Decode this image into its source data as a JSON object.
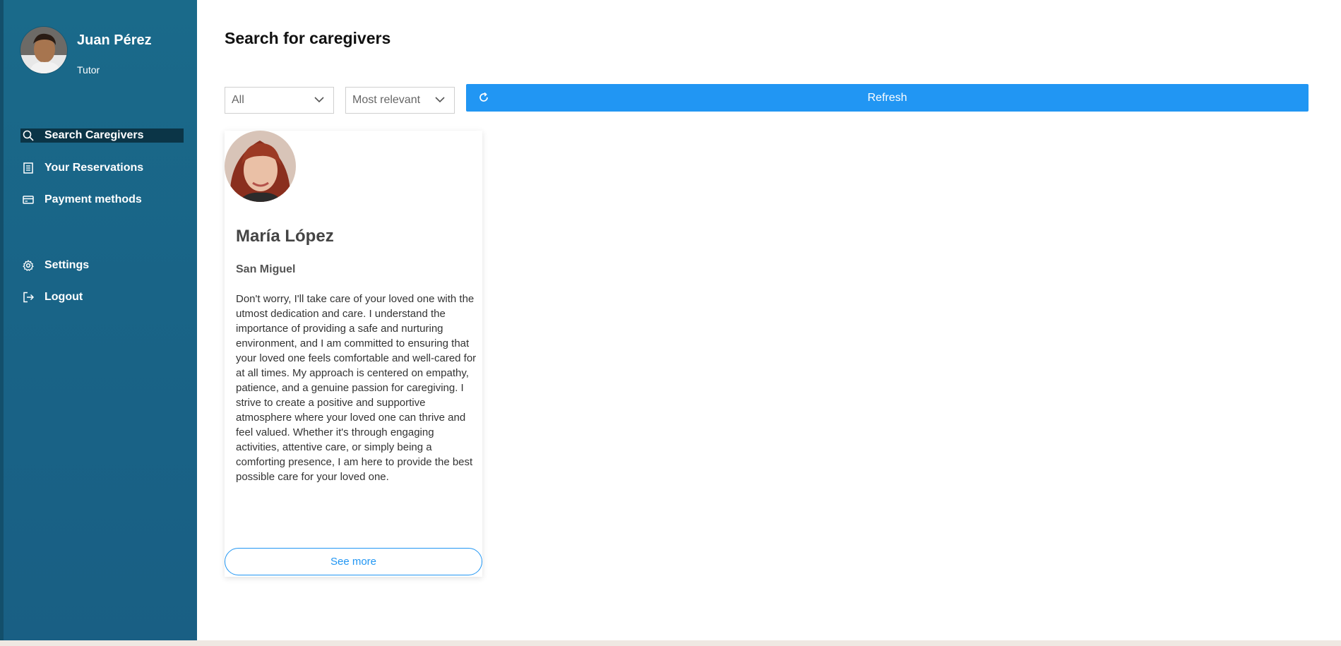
{
  "user": {
    "name": "Juan Pérez",
    "role": "Tutor"
  },
  "sidebar": {
    "items": [
      {
        "label": "Search Caregivers",
        "icon": "search-icon",
        "active": true
      },
      {
        "label": "Your Reservations",
        "icon": "document-icon",
        "active": false
      },
      {
        "label": "Payment methods",
        "icon": "credit-card-icon",
        "active": false
      },
      {
        "label": "Settings",
        "icon": "gear-icon",
        "active": false
      },
      {
        "label": "Logout",
        "icon": "logout-icon",
        "active": false
      }
    ]
  },
  "main": {
    "title": "Search for caregivers",
    "filters": {
      "category": "All",
      "sort": "Most relevant"
    },
    "refresh_label": "Refresh"
  },
  "caregivers": [
    {
      "name": "María López",
      "location": "San Miguel",
      "description": "Don't worry, I'll take care of your loved one with the utmost dedication and care. I understand the importance of providing a safe and nurturing environment, and I am committed to ensuring that your loved one feels comfortable and well-cared for at all times. My approach is centered on empathy, patience, and a genuine passion for caregiving. I strive to create a positive and supportive atmosphere where your loved one can thrive and feel valued. Whether it's through engaging activities, attentive care, or simply being a comforting presence, I am here to provide the best possible care for your loved one.",
      "see_more_label": "See more"
    }
  ],
  "colors": {
    "sidebar": "#196487",
    "active_item": "#0b3547",
    "accent": "#2196f3"
  }
}
